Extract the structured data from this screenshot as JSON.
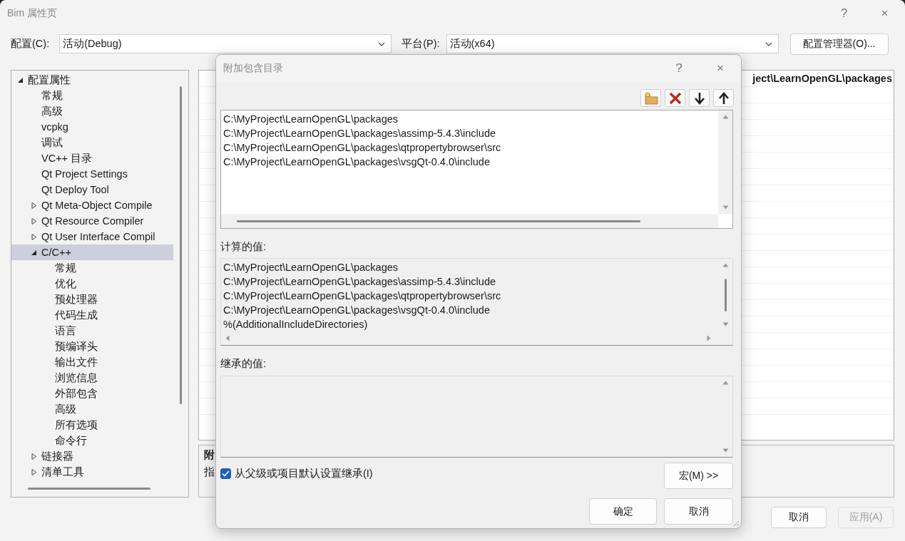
{
  "window": {
    "title": "Bim 属性页",
    "help": "?",
    "close": "×"
  },
  "config_row": {
    "config_label": "配置(C):",
    "config_value": "活动(Debug)",
    "platform_label": "平台(P):",
    "platform_value": "活动(x64)",
    "manager_button": "配置管理器(O)..."
  },
  "tree": [
    {
      "label": "配置属性",
      "kind": "group",
      "expanded": true,
      "selected": false,
      "children": [
        {
          "label": "常规",
          "kind": "leaf",
          "selected": false
        },
        {
          "label": "高级",
          "kind": "leaf",
          "selected": false
        },
        {
          "label": "vcpkg",
          "kind": "leaf",
          "selected": false
        },
        {
          "label": "调试",
          "kind": "leaf",
          "selected": false
        },
        {
          "label": "VC++ 目录",
          "kind": "leaf",
          "selected": false
        },
        {
          "label": "Qt Project Settings",
          "kind": "leaf",
          "selected": false
        },
        {
          "label": "Qt Deploy Tool",
          "kind": "leaf",
          "selected": false
        },
        {
          "label": "Qt Meta-Object Compile",
          "kind": "group",
          "expanded": false,
          "selected": false
        },
        {
          "label": "Qt Resource Compiler",
          "kind": "group",
          "expanded": false,
          "selected": false
        },
        {
          "label": "Qt User Interface Compil",
          "kind": "group",
          "expanded": false,
          "selected": false
        },
        {
          "label": "C/C++",
          "kind": "group",
          "expanded": true,
          "selected": true,
          "children": [
            {
              "label": "常规",
              "kind": "leaf",
              "selected": false
            },
            {
              "label": "优化",
              "kind": "leaf",
              "selected": false
            },
            {
              "label": "预处理器",
              "kind": "leaf",
              "selected": false
            },
            {
              "label": "代码生成",
              "kind": "leaf",
              "selected": false
            },
            {
              "label": "语言",
              "kind": "leaf",
              "selected": false
            },
            {
              "label": "预编译头",
              "kind": "leaf",
              "selected": false
            },
            {
              "label": "输出文件",
              "kind": "leaf",
              "selected": false
            },
            {
              "label": "浏览信息",
              "kind": "leaf",
              "selected": false
            },
            {
              "label": "外部包含",
              "kind": "leaf",
              "selected": false
            },
            {
              "label": "高级",
              "kind": "leaf",
              "selected": false
            },
            {
              "label": "所有选项",
              "kind": "leaf",
              "selected": false
            },
            {
              "label": "命令行",
              "kind": "leaf",
              "selected": false
            }
          ]
        },
        {
          "label": "链接器",
          "kind": "group",
          "expanded": false,
          "selected": false
        },
        {
          "label": "清单工具",
          "kind": "group",
          "expanded": false,
          "selected": false
        }
      ]
    }
  ],
  "property_grid": {
    "first_row_value": "ject\\LearnOpenGL\\packages"
  },
  "description": {
    "title": "附",
    "text": "指"
  },
  "buttons": [
    {
      "label": "取消",
      "disabled": false
    },
    {
      "label": "应用(A)",
      "disabled": true
    }
  ],
  "dialog": {
    "title": "附加包含目录",
    "help": "?",
    "close": "×",
    "toolbar": [
      {
        "kind": "new-folder"
      },
      {
        "kind": "delete"
      },
      {
        "kind": "move-down"
      },
      {
        "kind": "move-up"
      }
    ],
    "entries": [
      "C:\\MyProject\\LearnOpenGL\\packages",
      "C:\\MyProject\\LearnOpenGL\\packages\\assimp-5.4.3\\include",
      "C:\\MyProject\\LearnOpenGL\\packages\\qtpropertybrowser\\src",
      "C:\\MyProject\\LearnOpenGL\\packages\\vsgQt-0.4.0\\include"
    ],
    "evaluated_label": "计算的值:",
    "evaluated": [
      "C:\\MyProject\\LearnOpenGL\\packages",
      "C:\\MyProject\\LearnOpenGL\\packages\\assimp-5.4.3\\include",
      "C:\\MyProject\\LearnOpenGL\\packages\\qtpropertybrowser\\src",
      "C:\\MyProject\\LearnOpenGL\\packages\\vsgQt-0.4.0\\include",
      "%(AdditionalIncludeDirectories)"
    ],
    "inherited_label": "继承的值:",
    "inherit_checkbox": {
      "label": "从父级或项目默认设置继承(I)",
      "checked": true
    },
    "macro_button": "宏(M) >>",
    "buttons": [
      "确定",
      "取消"
    ]
  }
}
